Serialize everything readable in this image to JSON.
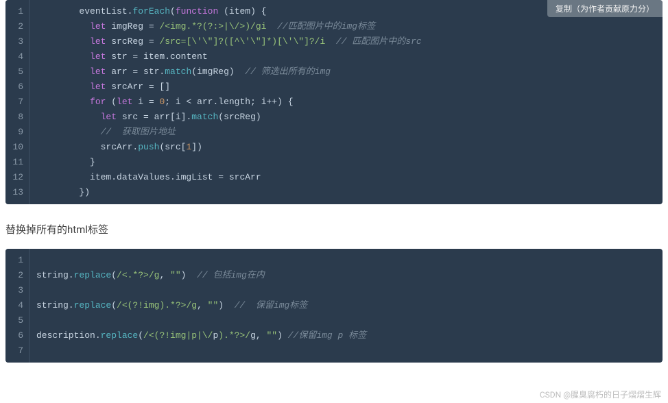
{
  "copy_button_label": "复制（为作者贡献原力分）",
  "section_heading": "替换掉所有的html标签",
  "watermark": "CSDN @腥臭腐朽的日子熠熠生辉",
  "block1": {
    "lines": [
      "        eventList.§fn§forEach§/§(§kw§function§/§ (item) {",
      "          §kw§let§/§ imgReg = §re§/<img.*?(?:>|\\/>)/gi§/§  §cmt§//匹配图片中的img标签§/§",
      "          §kw§let§/§ srcReg = §re§/src=[\\'\\\"]?([^\\'\\\"]*)[\\'\\\"]?/i§/§  §cmt§// 匹配图片中的src§/§",
      "          §kw§let§/§ str = item.content",
      "          §kw§let§/§ arr = str.§fn§match§/§(imgReg)  §cmt§// 筛选出所有的img§/§",
      "          §kw§let§/§ srcArr = []",
      "          §kw§for§/§ (§kw§let§/§ i = §num§0§/§; i < arr.length; i++) {",
      "            §kw§let§/§ src = arr[i].§fn§match§/§(srcReg)",
      "            §cmt§//  获取图片地址§/§",
      "            srcArr.§fn§push§/§(src[§num§1§/§])",
      "          }",
      "          item.dataValues.imgList = srcArr",
      "        })"
    ]
  },
  "block2": {
    "lines": [
      "",
      "string.§fn§replace§/§(§re§/<.*?>/g§/§, §str§\"\"§/§)  §cmt§// 包括img在内§/§",
      "",
      "string.§fn§replace§/§(§re§/<(?!img).*?>/g§/§, §str§\"\"§/§)  §cmt§//  保留img标签§/§",
      "",
      "description.§fn§replace§/§(§re§/<(?!img|p|\\/§/§p§re§).*?>/§/§g, §str§\"\"§/§) §cmt§//保留img p 标签§/§",
      ""
    ]
  },
  "chart_data": null
}
